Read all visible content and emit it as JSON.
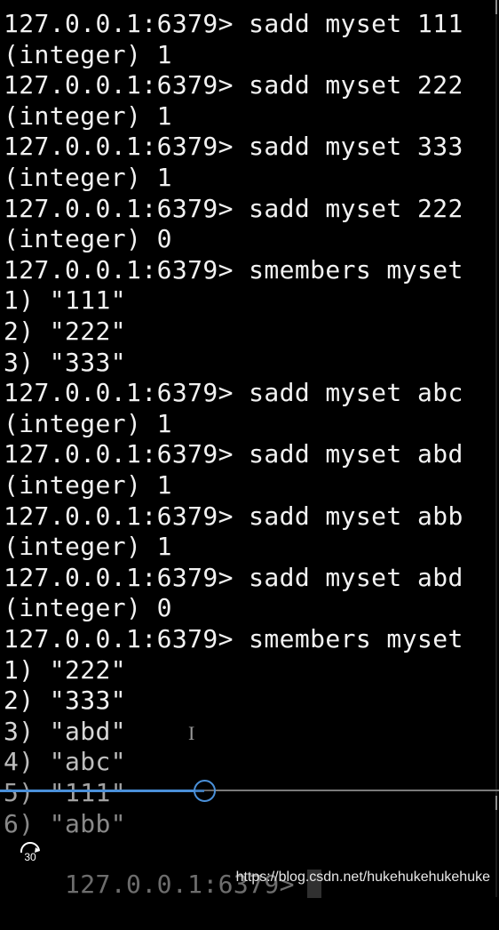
{
  "terminal": {
    "lines": [
      "127.0.0.1:6379> sadd myset 111",
      "(integer) 1",
      "127.0.0.1:6379> sadd myset 222",
      "(integer) 1",
      "127.0.0.1:6379> sadd myset 333",
      "(integer) 1",
      "127.0.0.1:6379> sadd myset 222",
      "(integer) 0",
      "127.0.0.1:6379> smembers myset",
      "1) \"111\"",
      "2) \"222\"",
      "3) \"333\"",
      "127.0.0.1:6379> sadd myset abc",
      "(integer) 1",
      "127.0.0.1:6379> sadd myset abd",
      "(integer) 1",
      "127.0.0.1:6379> sadd myset abb",
      "(integer) 1",
      "127.0.0.1:6379> sadd myset abd",
      "(integer) 0",
      "127.0.0.1:6379> smembers myset",
      "1) \"222\"",
      "2) \"333\"",
      "3) \"abd\"",
      "4) \"abc\"",
      "5) \"111\"",
      "6) \"abb\""
    ],
    "prompt": "127.0.0.1:6379>"
  },
  "player": {
    "replay_seconds": "30",
    "progress": 0.41
  },
  "watermark": "https://blog.csdn.net/hukehukehukehuke",
  "colors": {
    "background": "#000000",
    "text": "#f2f2f2",
    "accent": "#4a90d9"
  }
}
